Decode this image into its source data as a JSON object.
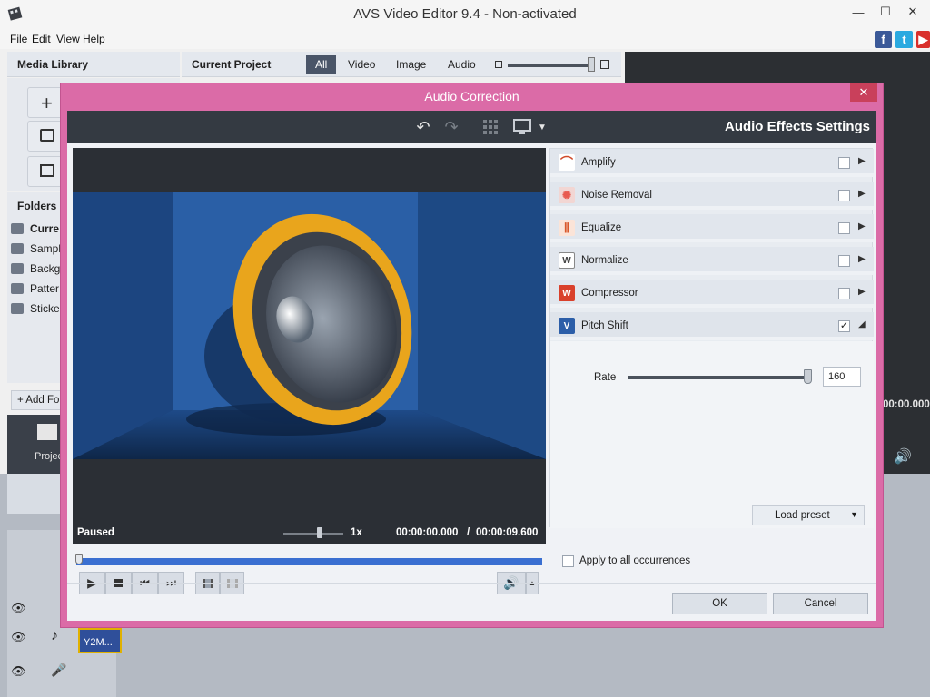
{
  "app": {
    "title": "AVS Video Editor 9.4 - Non-activated",
    "menu": [
      "File",
      "Edit",
      "View",
      "Help"
    ]
  },
  "media_library": {
    "title": "Media Library",
    "add_folder": "Add Fo",
    "projects_label": "Projec",
    "folders_title": "Folders",
    "folders": [
      "Curre",
      "Sample",
      "Backgr",
      "Patter",
      "Sticker"
    ]
  },
  "current_project": {
    "title": "Current Project",
    "tabs": [
      "All",
      "Video",
      "Image",
      "Audio"
    ],
    "active_tab": "All"
  },
  "right_panel": {
    "timecode": "00:00.000"
  },
  "timeline": {
    "clip_label": "Y2M..."
  },
  "dialog": {
    "title": "Audio Correction",
    "settings_heading": "Audio Effects Settings",
    "status": "Paused",
    "speed": "1x",
    "time_current": "00:00:00.000",
    "time_separator": "/",
    "time_total": "00:00:09.600",
    "effects": [
      {
        "label": "Amplify",
        "checked": "",
        "arrow": "▶",
        "icon": "amplify-icon",
        "color": "#ffffff"
      },
      {
        "label": "Noise Removal",
        "checked": "",
        "arrow": "▶",
        "icon": "noise-removal-icon",
        "color": "#e85a4f"
      },
      {
        "label": "Equalize",
        "checked": "",
        "arrow": "▶",
        "icon": "equalize-icon",
        "color": "#d9582b"
      },
      {
        "label": "Normalize",
        "checked": "",
        "arrow": "▶",
        "icon": "normalize-icon",
        "color": "#ffffff"
      },
      {
        "label": "Compressor",
        "checked": "",
        "arrow": "▶",
        "icon": "compressor-icon",
        "color": "#d9402b"
      },
      {
        "label": "Pitch Shift",
        "checked": "✓",
        "arrow": "◢",
        "icon": "pitch-shift-icon",
        "color": "#2c5ea8"
      }
    ],
    "rate_label": "Rate",
    "rate_value": "160",
    "rate_level": 1.0,
    "load_preset": "Load preset",
    "apply_all": "Apply to all occurrences",
    "ok": "OK",
    "cancel": "Cancel"
  }
}
